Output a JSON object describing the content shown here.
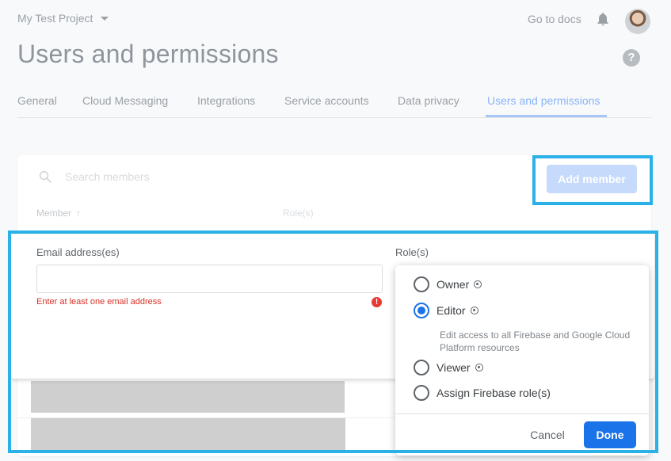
{
  "header": {
    "project_name": "My Test Project",
    "docs_link": "Go to docs",
    "page_title": "Users and permissions"
  },
  "tabs": [
    {
      "label": "General"
    },
    {
      "label": "Cloud Messaging"
    },
    {
      "label": "Integrations"
    },
    {
      "label": "Service accounts"
    },
    {
      "label": "Data privacy"
    },
    {
      "label": "Users and permissions",
      "active": true
    }
  ],
  "members": {
    "search_placeholder": "Search members",
    "add_member_label": "Add member",
    "columns": {
      "member": "Member",
      "role": "Role(s)"
    }
  },
  "add_panel": {
    "email_label": "Email address(es)",
    "email_value": "",
    "email_error": "Enter at least one email address",
    "roles_label": "Role(s)"
  },
  "role_popup": {
    "options": [
      {
        "label": "Owner",
        "checked": false,
        "info": true
      },
      {
        "label": "Editor",
        "checked": true,
        "info": true
      },
      {
        "label": "Viewer",
        "checked": false,
        "info": true
      },
      {
        "label": "Assign Firebase role(s)",
        "checked": false,
        "info": false
      }
    ],
    "editor_description": "Edit access to all Firebase and Google Cloud Platform resources",
    "cancel_label": "Cancel",
    "done_label": "Done"
  },
  "colors": {
    "highlight": "#29b1e8",
    "primary": "#1a73e8",
    "error": "#d93025",
    "active_tab": "#8ab4f8"
  }
}
